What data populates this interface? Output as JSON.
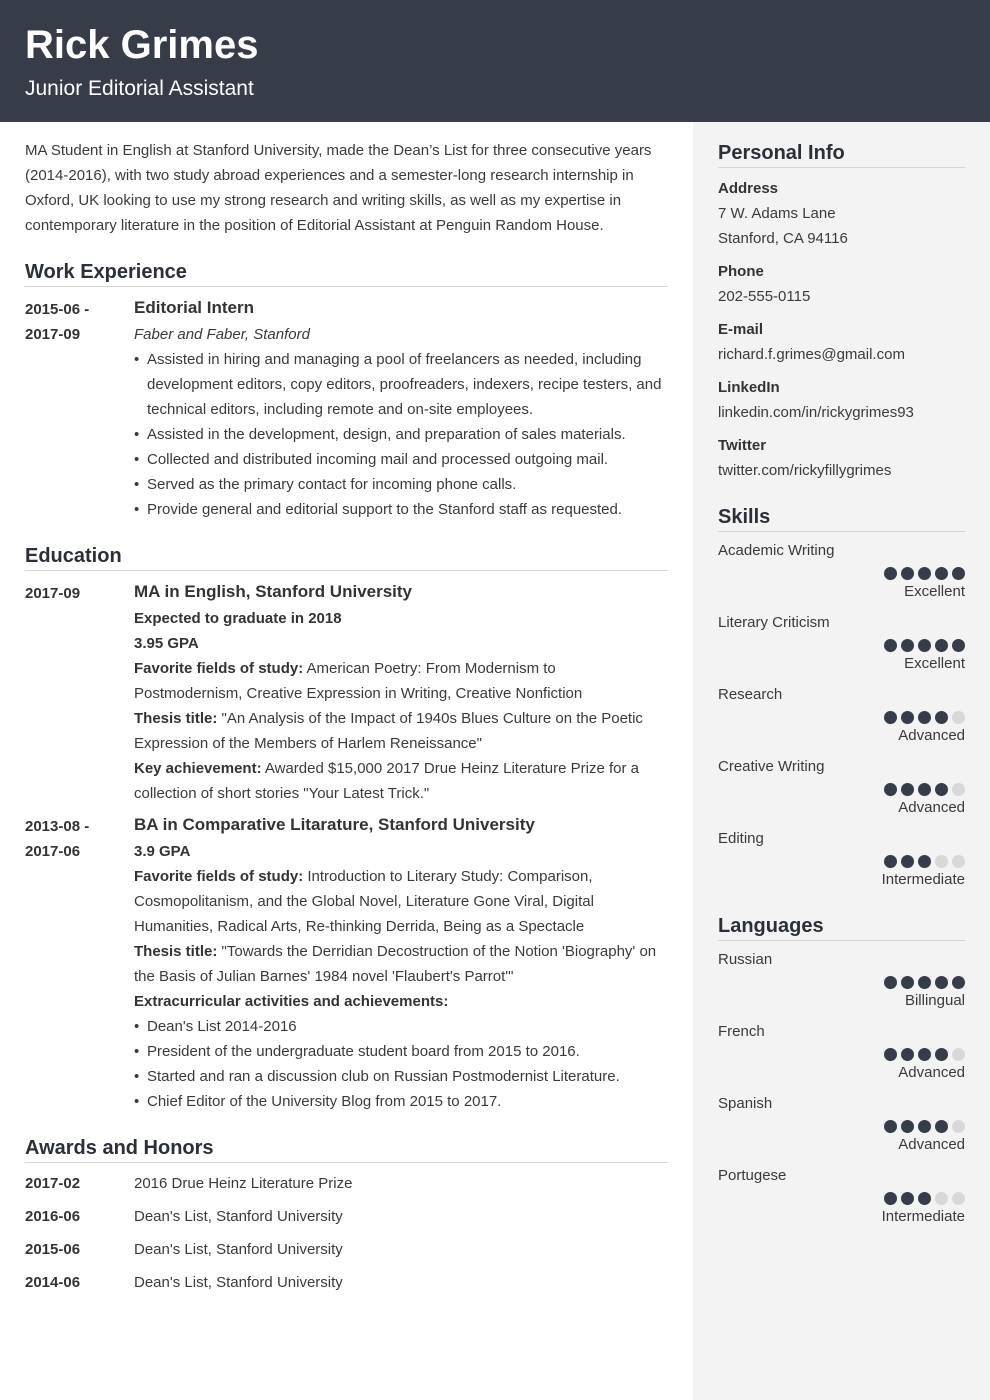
{
  "header": {
    "name": "Rick Grimes",
    "title": "Junior Editorial Assistant"
  },
  "colors": {
    "header_bg": "#373c49",
    "sidebar_bg": "#f3f3f3",
    "dot_filled": "#373c49",
    "dot_empty": "#d8d8d8"
  },
  "summary": "MA Student in English at Stanford University, made the Dean’s List for three consecutive years (2014-2016), with two study abroad experiences and a semester-long research internship in Oxford, UK looking to use my strong research and writing skills, as well as my expertise in contemporary literature in the position of Editorial Assistant at Penguin Random House.",
  "work": {
    "title": "Work Experience",
    "entries": [
      {
        "date_start": "2015-06 -",
        "date_end": "2017-09",
        "role": "Editorial Intern",
        "company": "Faber and Faber, Stanford",
        "bullets": [
          "Assisted in hiring and managing a pool of freelancers as needed, including development editors, copy editors, proofreaders, indexers, recipe testers, and technical editors, including remote and on-site employees.",
          "Assisted in the development, design, and preparation of sales materials.",
          "Collected and distributed incoming mail and processed outgoing mail.",
          "Served as the primary contact for incoming phone calls.",
          "Provide general and editorial support to the Stanford staff as requested."
        ]
      }
    ]
  },
  "education": {
    "title": "Education",
    "entries": [
      {
        "date_start": "2017-09",
        "date_end": "",
        "degree": "MA in English, Stanford University",
        "expected": "Expected to graduate in 2018",
        "gpa": "3.95 GPA",
        "fields_label": "Favorite fields of study:",
        "fields": " American Poetry: From Modernism to Postmodernism, Creative Expression in Writing, Creative Nonfiction",
        "thesis_label": "Thesis title:",
        "thesis": " \"An Analysis of the Impact of 1940s Blues Culture on the Poetic Expression of the Members of Harlem Reneissance\"",
        "achievement_label": "Key achievement:",
        "achievement": " Awarded $15,000 2017 Drue Heinz Literature Prize for a collection of short stories \"Your Latest Trick.\""
      },
      {
        "date_start": "2013-08 -",
        "date_end": "2017-06",
        "degree": "BA in Comparative Litarature, Stanford University",
        "gpa": "3.9 GPA",
        "fields_label": "Favorite fields of study:",
        "fields": " Introduction to Literary Study: Comparison, Cosmopolitanism, and the Global Novel, Literature Gone Viral, Digital Humanities, Radical Arts, Re-thinking Derrida, Being as a Spectacle",
        "thesis_label": "Thesis title:",
        "thesis": " \"Towards the Derridian Decostruction of the Notion 'Biography' on the Basis of Julian Barnes' 1984 novel 'Flaubert's Parrot'\"",
        "extra_label": "Extracurricular activities and achievements:",
        "extra": [
          "Dean's List 2014-2016",
          "President of the undergraduate student board from 2015 to 2016.",
          "Started and ran a discussion club on Russian Postmodernist Literature.",
          "Chief Editor of the University Blog from 2015 to 2017."
        ]
      }
    ]
  },
  "awards": {
    "title": "Awards and Honors",
    "items": [
      {
        "date": "2017-02",
        "text": "2016 Drue Heinz Literature Prize"
      },
      {
        "date": "2016-06",
        "text": "Dean's List, Stanford University"
      },
      {
        "date": "2015-06",
        "text": "Dean's List, Stanford University"
      },
      {
        "date": "2014-06",
        "text": "Dean's List, Stanford University"
      }
    ]
  },
  "personal_info": {
    "title": "Personal Info",
    "address_label": "Address",
    "address_line1": "7 W. Adams Lane",
    "address_line2": "Stanford, CA 94116",
    "phone_label": "Phone",
    "phone": "202-555-0115",
    "email_label": "E-mail",
    "email": "richard.f.grimes@gmail.com",
    "linkedin_label": "LinkedIn",
    "linkedin": "linkedin.com/in/rickygrimes93",
    "twitter_label": "Twitter",
    "twitter": "twitter.com/rickyfillygrimes"
  },
  "skills": {
    "title": "Skills",
    "items": [
      {
        "name": "Academic Writing",
        "rating": 5,
        "max": 5,
        "level": "Excellent"
      },
      {
        "name": "Literary Criticism",
        "rating": 5,
        "max": 5,
        "level": "Excellent"
      },
      {
        "name": "Research",
        "rating": 4,
        "max": 5,
        "level": "Advanced"
      },
      {
        "name": "Creative Writing",
        "rating": 4,
        "max": 5,
        "level": "Advanced"
      },
      {
        "name": "Editing",
        "rating": 3,
        "max": 5,
        "level": "Intermediate"
      }
    ]
  },
  "languages": {
    "title": "Languages",
    "items": [
      {
        "name": "Russian",
        "rating": 5,
        "max": 5,
        "level": "Billingual"
      },
      {
        "name": "French",
        "rating": 4,
        "max": 5,
        "level": "Advanced"
      },
      {
        "name": "Spanish",
        "rating": 4,
        "max": 5,
        "level": "Advanced"
      },
      {
        "name": "Portugese",
        "rating": 3,
        "max": 5,
        "level": "Intermediate"
      }
    ]
  }
}
